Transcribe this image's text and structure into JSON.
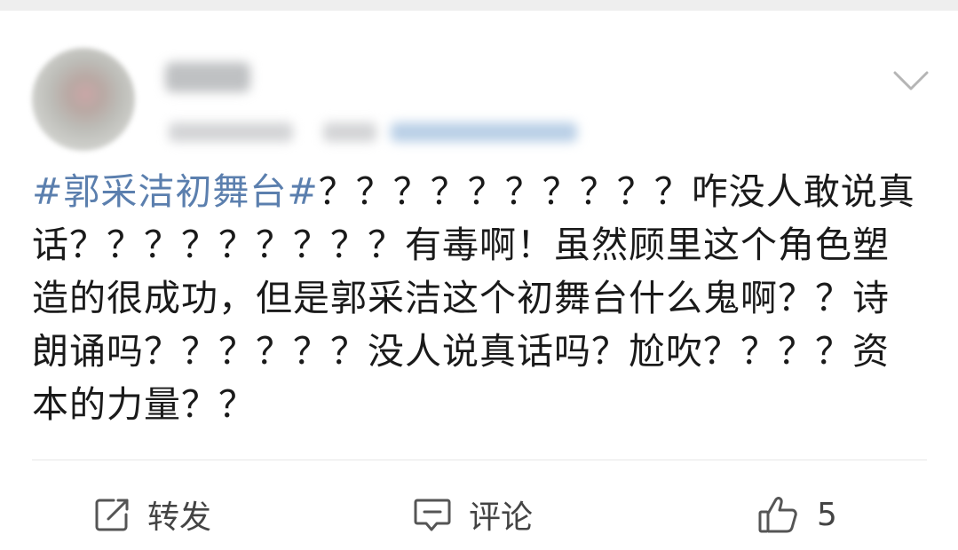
{
  "post": {
    "hashtag": "#郭采洁初舞台#",
    "body": "？？？？？？？？？？咋没人敢说真话？？？？？？？？？有毒啊！虽然顾里这个角色塑造的很成功，但是郭采洁这个初舞台什么鬼啊？？诗朗诵吗？？？？？？没人说真话吗？尬吹？？？？资本的力量？？"
  },
  "actions": {
    "repost_label": "转发",
    "comment_label": "评论",
    "like_count": "5"
  },
  "colors": {
    "hashtag": "#5b7fae",
    "text": "#1a1a1a",
    "action_text": "#444444",
    "divider": "#e6e6e6"
  },
  "icons": {
    "repost": "share-edit-icon",
    "comment": "comment-bubble-icon",
    "like": "thumbs-up-icon",
    "more": "chevron-down-icon"
  }
}
